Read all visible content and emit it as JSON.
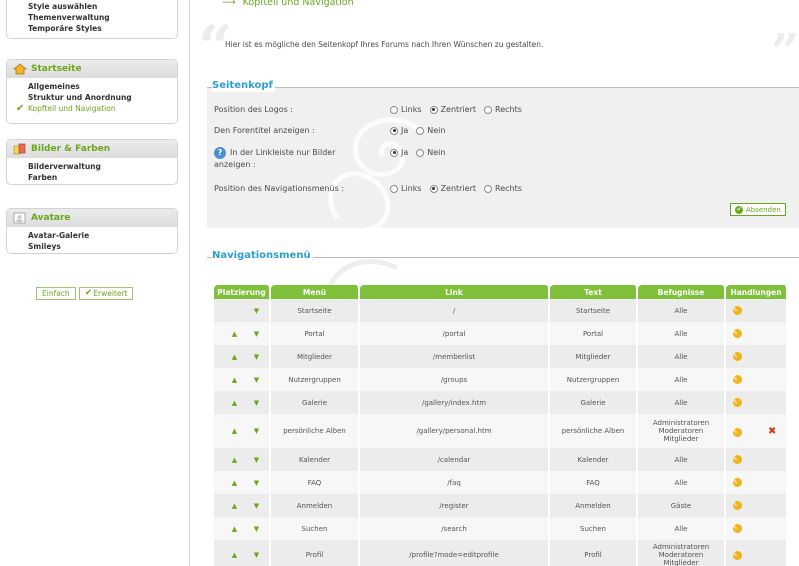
{
  "sidebar": {
    "top_items": [
      "Style auswählen",
      "Themenverwaltung",
      "Temporäre Styles"
    ],
    "sections": [
      {
        "title": "Startseite",
        "icon": "home-icon",
        "items": [
          {
            "label": "Allgemeines",
            "active": false
          },
          {
            "label": "Struktur und Anordnung",
            "active": false
          },
          {
            "label": "Kopfteil und Navigation",
            "active": true
          }
        ]
      },
      {
        "title": "Bilder & Farben",
        "icon": "palette-icon",
        "items": [
          {
            "label": "Bilderverwaltung",
            "active": false
          },
          {
            "label": "Farben",
            "active": false
          }
        ]
      },
      {
        "title": "Avatare",
        "icon": "avatar-icon",
        "items": [
          {
            "label": "Avatar-Galerie",
            "active": false
          },
          {
            "label": "Smileys",
            "active": false
          }
        ]
      }
    ],
    "mode_simple": "Einfach",
    "mode_extended": "Erweitert"
  },
  "main": {
    "breadcrumb": "Kopfteil und Navigation",
    "intro": "Hier ist es mögliche den Seitenkopf Ihres Forums nach Ihren Wünschen zu gestalten.",
    "header_panel": {
      "title": "Seitenkopf",
      "logo_label": "Position des Logos :",
      "logo_options": [
        "Links",
        "Zentriert",
        "Rechts"
      ],
      "logo_selected": "Zentriert",
      "forum_title_label": "Den Forentitel anzeigen :",
      "forum_title_options": [
        "Ja",
        "Nein"
      ],
      "forum_title_selected": "Ja",
      "linkbar_label": "In der Linkleiste nur Bilder anzeigen :",
      "linkbar_options": [
        "Ja",
        "Nein"
      ],
      "linkbar_selected": "Ja",
      "navpos_label": "Position des Navigationsmenüs :",
      "navpos_options": [
        "Links",
        "Zentriert",
        "Rechts"
      ],
      "navpos_selected": "Zentriert",
      "submit_label": "Absenden"
    },
    "nav_panel": {
      "title": "Navigationsmenü",
      "columns": [
        "Platzierung",
        "Menü",
        "Link",
        "Text",
        "Befugnisse",
        "Handlungen"
      ],
      "rows": [
        {
          "menu": "Startseite",
          "link": "/",
          "text": "Startseite",
          "perm": "Alle",
          "up": false,
          "deletable": false
        },
        {
          "menu": "Portal",
          "link": "/portal",
          "text": "Portal",
          "perm": "Alle",
          "up": true,
          "deletable": false
        },
        {
          "menu": "Mitglieder",
          "link": "/memberlist",
          "text": "Mitglieder",
          "perm": "Alle",
          "up": true,
          "deletable": false
        },
        {
          "menu": "Nutzergruppen",
          "link": "/groups",
          "text": "Nutzergruppen",
          "perm": "Alle",
          "up": true,
          "deletable": false
        },
        {
          "menu": "Galerie",
          "link": "/gallery/index.htm",
          "text": "Galerie",
          "perm": "Alle",
          "up": true,
          "deletable": false
        },
        {
          "menu": "persönliche Alben",
          "link": "/gallery/personal.htm",
          "text": "persönliche Alben",
          "perm": "Administratoren\nModeratoren\nMitglieder",
          "up": true,
          "deletable": true
        },
        {
          "menu": "Kalender",
          "link": "/calendar",
          "text": "Kalender",
          "perm": "Alle",
          "up": true,
          "deletable": false
        },
        {
          "menu": "FAQ",
          "link": "/faq",
          "text": "FAQ",
          "perm": "Alle",
          "up": true,
          "deletable": false
        },
        {
          "menu": "Anmelden",
          "link": "/register",
          "text": "Anmelden",
          "perm": "Gäste",
          "up": true,
          "deletable": false
        },
        {
          "menu": "Suchen",
          "link": "/search",
          "text": "Suchen",
          "perm": "Alle",
          "up": true,
          "deletable": false
        },
        {
          "menu": "Profil",
          "link": "/profile?mode=editprofile",
          "text": "Profil",
          "perm": "Administratoren\nModeratoren\nMitglieder",
          "up": true,
          "deletable": false
        }
      ]
    }
  },
  "colors": {
    "accent_green": "#6aa71d",
    "header_green": "#7fc13a",
    "title_blue": "#2e9fd3",
    "edit_orange": "#f2b21b",
    "delete_red": "#d23b1c"
  }
}
